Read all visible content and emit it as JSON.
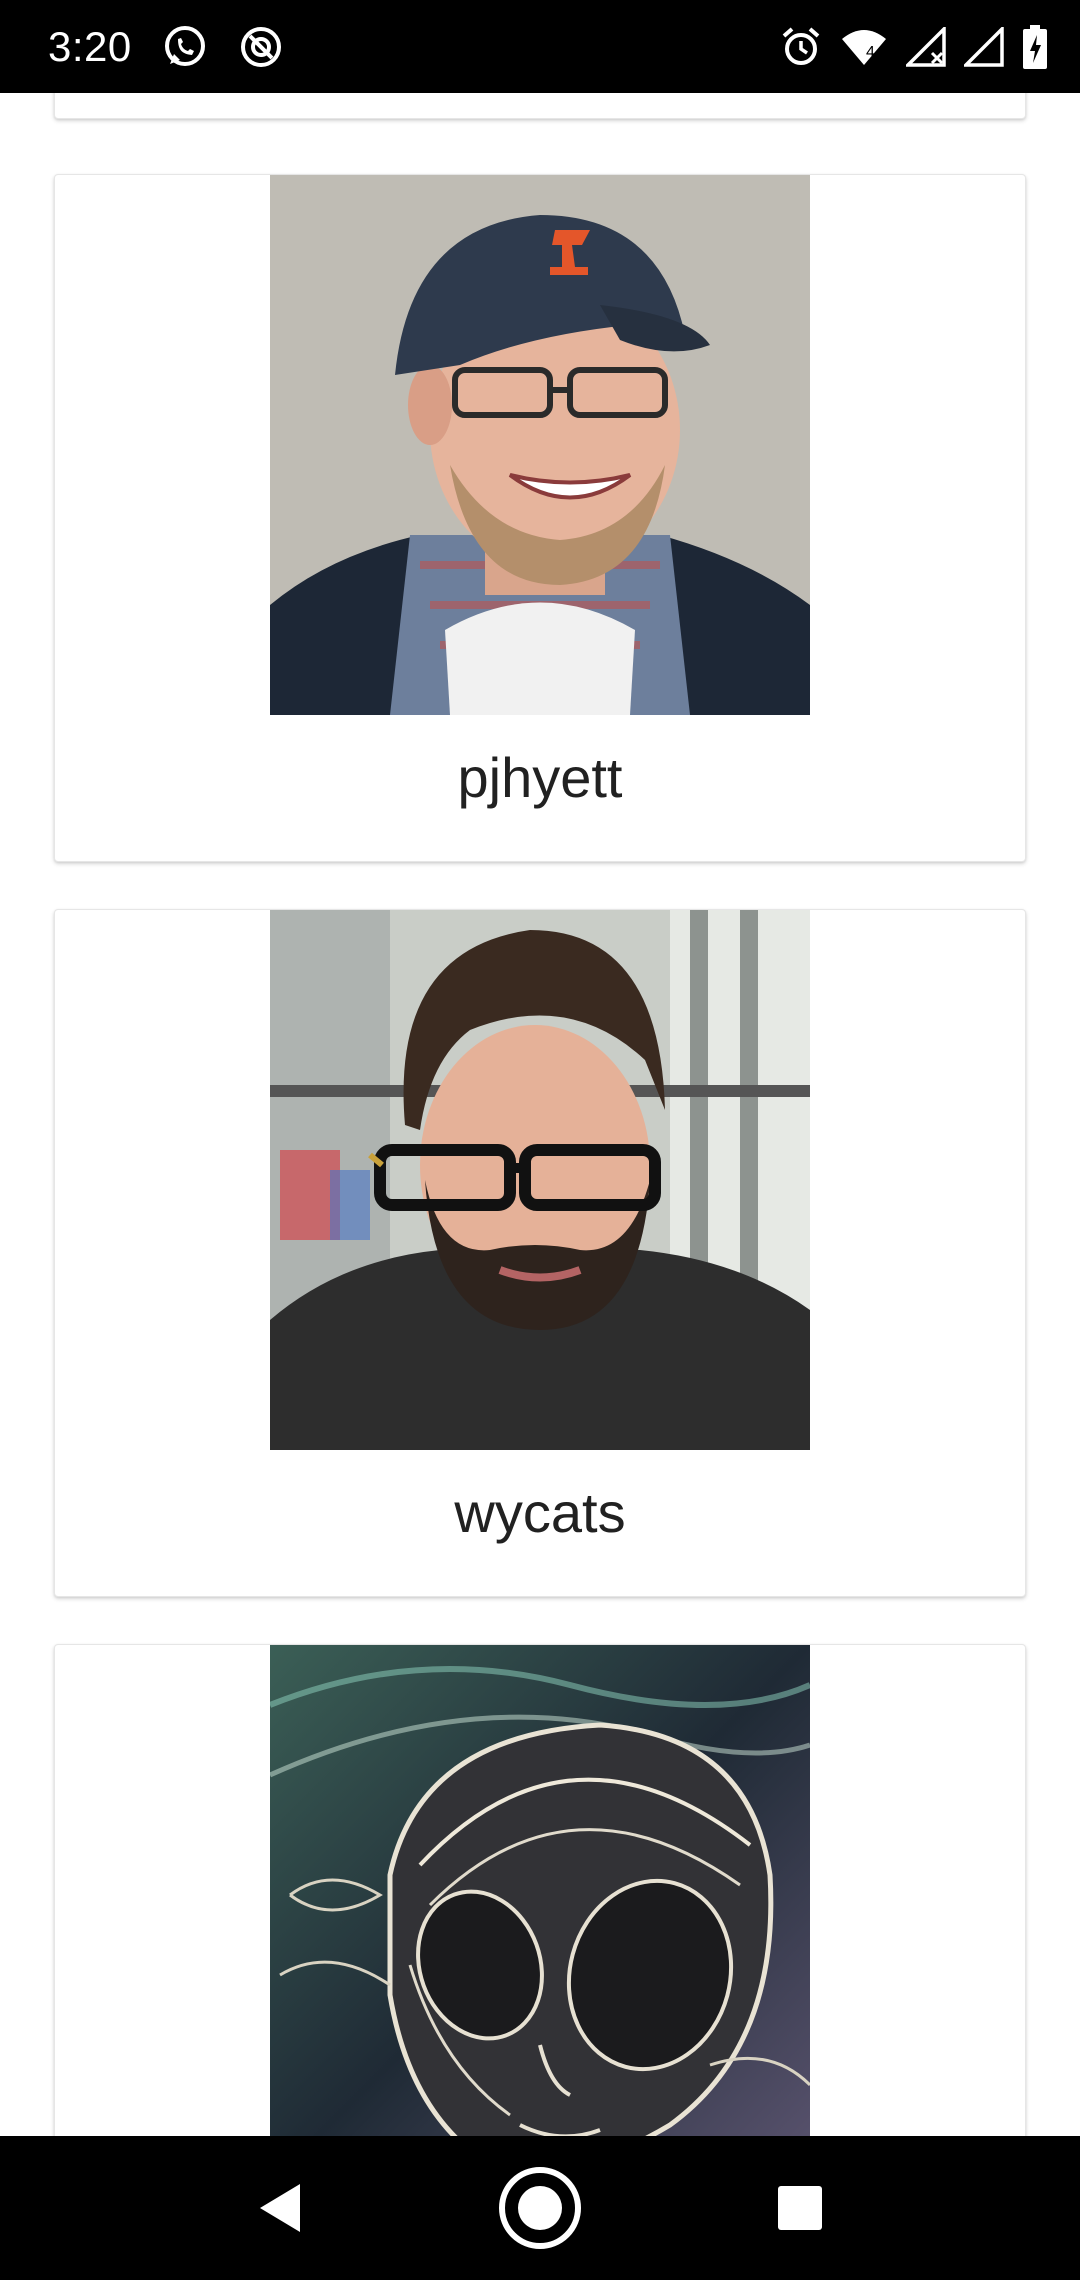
{
  "status_bar": {
    "time": "3:20",
    "left_icons": [
      "whatsapp-icon",
      "do-not-disturb-icon"
    ],
    "right_icons": [
      "alarm-icon",
      "wifi-icon",
      "signal-icon",
      "signal-icon",
      "battery-charging-icon"
    ],
    "wifi_badge": "4"
  },
  "users": [
    {
      "name": "pjhyett",
      "avatar": "avatar-photo"
    },
    {
      "name": "wycats",
      "avatar": "avatar-photo"
    },
    {
      "name": "",
      "avatar": "avatar-artwork"
    }
  ],
  "nav_bar": {
    "buttons": [
      "back-icon",
      "home-icon",
      "recents-icon"
    ]
  },
  "colors": {
    "status_bar_bg": "#000000",
    "nav_bar_bg": "#000000",
    "card_bg": "#ffffff",
    "text": "#212121"
  }
}
